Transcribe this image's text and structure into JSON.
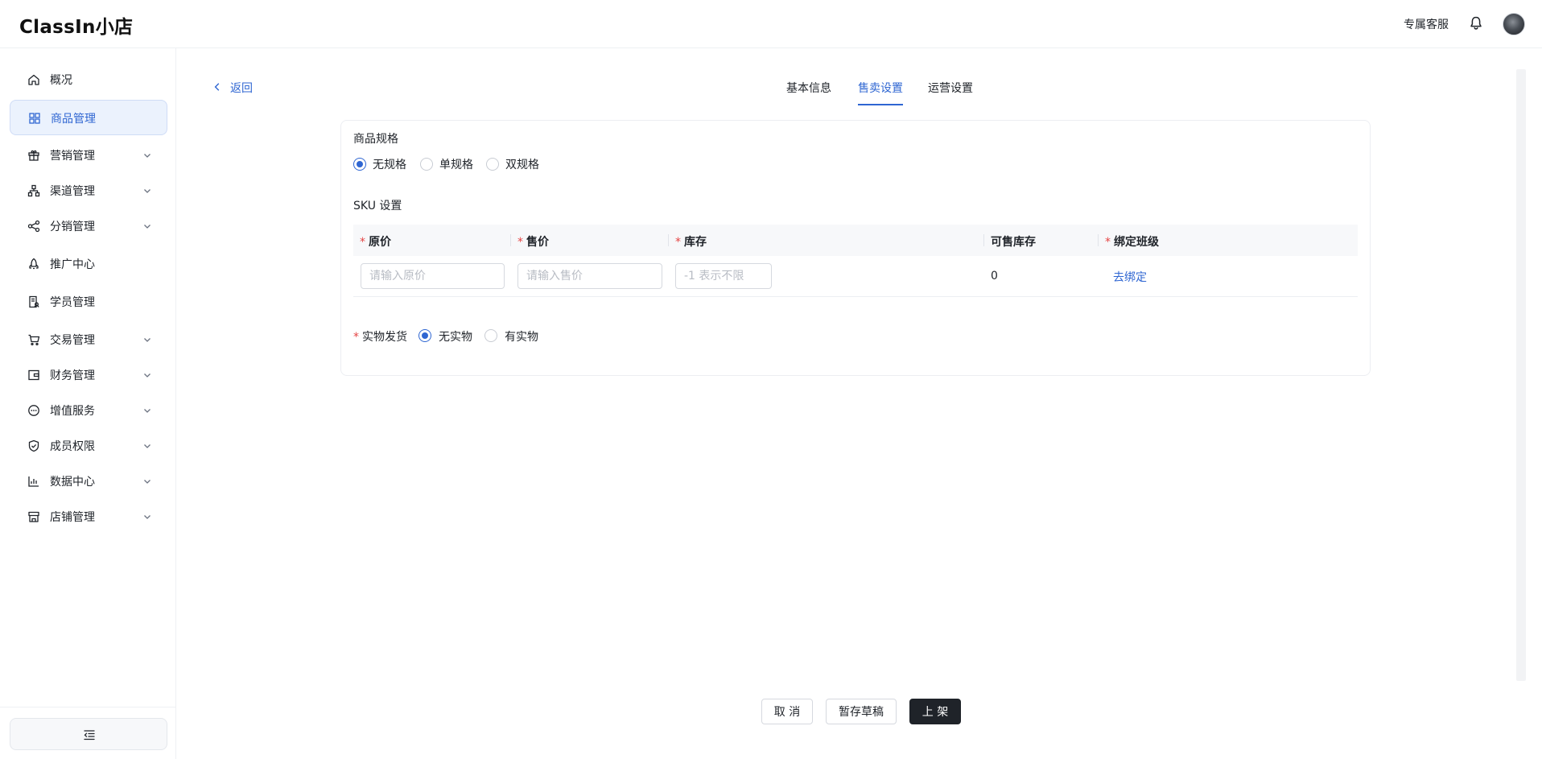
{
  "app": {
    "title": "ClassIn小店"
  },
  "header": {
    "service_label": "专属客服",
    "bell_icon": "bell-icon",
    "avatar_icon": "user-avatar"
  },
  "sidebar": {
    "items": [
      {
        "label": "概况",
        "icon": "home-icon",
        "expandable": false,
        "active": false
      },
      {
        "label": "商品管理",
        "icon": "grid-icon",
        "expandable": false,
        "active": true
      },
      {
        "label": "营销管理",
        "icon": "gift-icon",
        "expandable": true,
        "active": false
      },
      {
        "label": "渠道管理",
        "icon": "sitemap-icon",
        "expandable": true,
        "active": false
      },
      {
        "label": "分销管理",
        "icon": "share-icon",
        "expandable": true,
        "active": false
      },
      {
        "label": "推广中心",
        "icon": "rocket-icon",
        "expandable": false,
        "active": false
      },
      {
        "label": "学员管理",
        "icon": "student-icon",
        "expandable": false,
        "active": false
      },
      {
        "label": "交易管理",
        "icon": "cart-icon",
        "expandable": true,
        "active": false
      },
      {
        "label": "财务管理",
        "icon": "wallet-icon",
        "expandable": true,
        "active": false
      },
      {
        "label": "增值服务",
        "icon": "chat-icon",
        "expandable": true,
        "active": false
      },
      {
        "label": "成员权限",
        "icon": "shield-icon",
        "expandable": true,
        "active": false
      },
      {
        "label": "数据中心",
        "icon": "chart-icon",
        "expandable": true,
        "active": false
      },
      {
        "label": "店铺管理",
        "icon": "store-icon",
        "expandable": true,
        "active": false
      }
    ],
    "collapse_icon": "collapse-menu-icon"
  },
  "main": {
    "back_label": "返回",
    "tabs": [
      {
        "label": "基本信息",
        "active": false
      },
      {
        "label": "售卖设置",
        "active": true
      },
      {
        "label": "运营设置",
        "active": false
      }
    ],
    "spec": {
      "title": "商品规格",
      "options": [
        "无规格",
        "单规格",
        "双规格"
      ],
      "selected": "无规格"
    },
    "sku": {
      "title": "SKU 设置",
      "columns": [
        {
          "label": "原价",
          "required": true
        },
        {
          "label": "售价",
          "required": true
        },
        {
          "label": "库存",
          "required": true
        },
        {
          "label": "可售库存",
          "required": false
        },
        {
          "label": "绑定班级",
          "required": true
        }
      ],
      "row": {
        "original_price_placeholder": "请输入原价",
        "sale_price_placeholder": "请输入售价",
        "stock_placeholder": "-1 表示不限",
        "available_stock": "0",
        "bind_link": "去绑定"
      }
    },
    "shipping": {
      "label": "实物发货",
      "required": true,
      "options": [
        "无实物",
        "有实物"
      ],
      "selected": "无实物"
    }
  },
  "footer": {
    "cancel_label": "取 消",
    "draft_label": "暂存草稿",
    "publish_label": "上 架"
  },
  "colors": {
    "accent": "#2f66d2",
    "primary_button": "#1f2329",
    "required": "#e54545",
    "active_nav_bg": "#ebf2fd"
  }
}
